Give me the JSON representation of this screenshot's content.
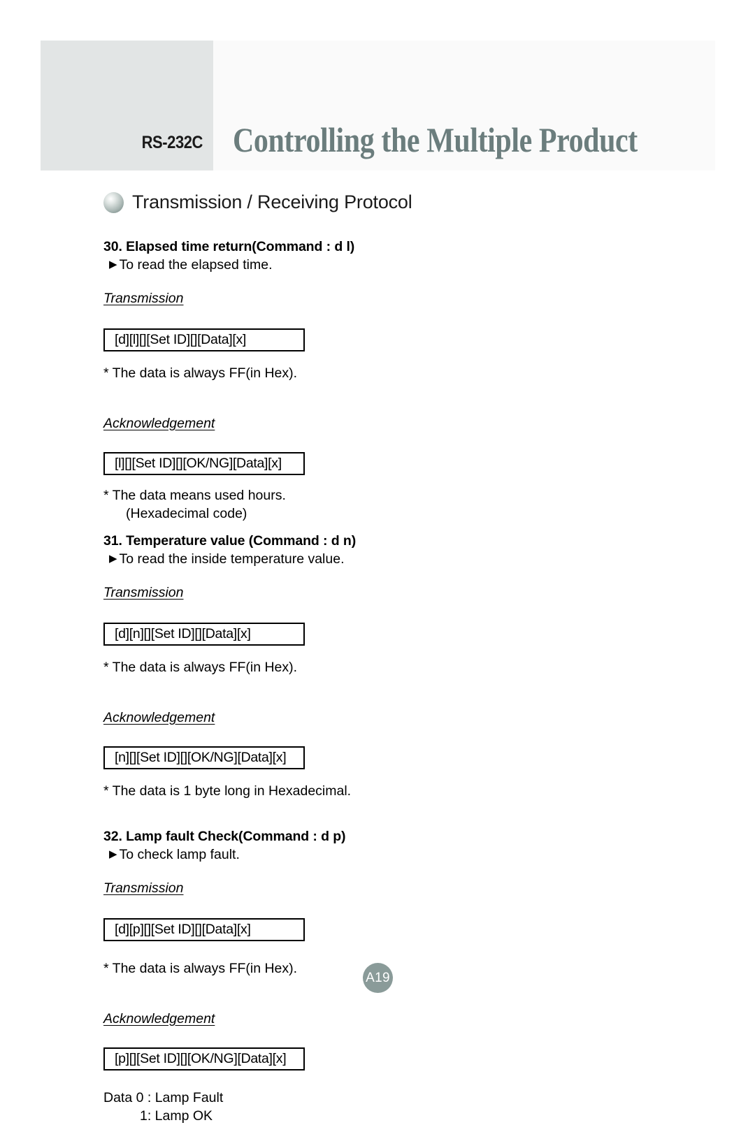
{
  "header": {
    "side_label": "RS-232C",
    "title": "Controlling the Multiple Product",
    "band_color": "#fafafa",
    "gray_box_color": "#e2e5e5",
    "title_color": "#6b7d7d"
  },
  "protocol_heading": {
    "bullet_icon": "sphere-bullet-icon",
    "text": "Transmission / Receiving Protocol"
  },
  "sections": [
    {
      "title": "30. Elapsed time return(Command : d l)",
      "marker": "▶",
      "description": "To read the elapsed time.",
      "transmission_label": "Transmission",
      "transmission_box": "[d][l][][Set ID][][Data][x]",
      "transmission_note": "* The data is always FF(in Hex).",
      "acknowledgement_label": "Acknowledgement",
      "acknowledgement_box": "[l][][Set ID][][OK/NG][Data][x]",
      "acknowledgement_note": "* The data means used hours.",
      "acknowledgement_note2": "(Hexadecimal code)"
    },
    {
      "title": "31. Temperature value (Command : d n)",
      "marker": "▶",
      "description": "To read the inside temperature value.",
      "transmission_label": "Transmission",
      "transmission_box": "[d][n][][Set ID][][Data][x]",
      "transmission_note": "* The data is always FF(in Hex).",
      "acknowledgement_label": "Acknowledgement",
      "acknowledgement_box": "[n][][Set ID][][OK/NG][Data][x]",
      "acknowledgement_note": "* The data  is 1 byte long in Hexadecimal."
    },
    {
      "title": "32. Lamp fault Check(Command : d p)",
      "marker": "▶",
      "description": "To check lamp fault.",
      "transmission_label": "Transmission",
      "transmission_box": "[d][p][][Set ID][][Data][x]",
      "transmission_note": "* The data is always FF(in Hex).",
      "acknowledgement_label": "Acknowledgement",
      "acknowledgement_box": "[p][][Set ID][][OK/NG][Data][x]",
      "data_line1": "Data 0 : Lamp Fault",
      "data_line2": "1: Lamp OK"
    }
  ],
  "footer": {
    "page_number": "A19",
    "badge_color": "#8a9b99"
  }
}
